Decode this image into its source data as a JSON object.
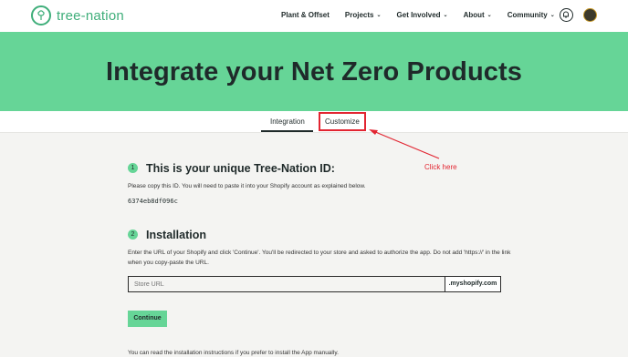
{
  "header": {
    "logo_text": "tree-nation",
    "nav": [
      {
        "label": "Plant & Offset",
        "has_chevron": false
      },
      {
        "label": "Projects",
        "has_chevron": true
      },
      {
        "label": "Get Involved",
        "has_chevron": true
      },
      {
        "label": "About",
        "has_chevron": true
      },
      {
        "label": "Community",
        "has_chevron": true
      }
    ],
    "chevron": "⌄"
  },
  "hero": {
    "title": "Integrate your Net Zero Products"
  },
  "tabs": {
    "integration": "Integration",
    "customize": "Customize"
  },
  "annotation": {
    "label": "Click here",
    "color": "#e22531"
  },
  "step1": {
    "number": "1",
    "title": "This is your unique Tree-Nation ID:",
    "instructions": "Please copy this ID. You will need to paste it into your Shopify account as explained below.",
    "id_value": "6374eb8df096c"
  },
  "step2": {
    "number": "2",
    "title": "Installation",
    "instructions": "Enter the URL of your Shopify and click 'Continue'. You'll be redirected to your store and asked to authorize the app. Do not add 'https://' in the link when you copy-paste the URL.",
    "input_placeholder": "Store URL",
    "input_value": "",
    "suffix": ".myshopify.com",
    "continue_label": "Continue"
  },
  "footer_text": "You can read the installation instructions if you prefer to install the App manually.",
  "colors": {
    "brand_green": "#66d597",
    "logo_green": "#3fae7a",
    "text_dark": "#1f2a2a"
  }
}
